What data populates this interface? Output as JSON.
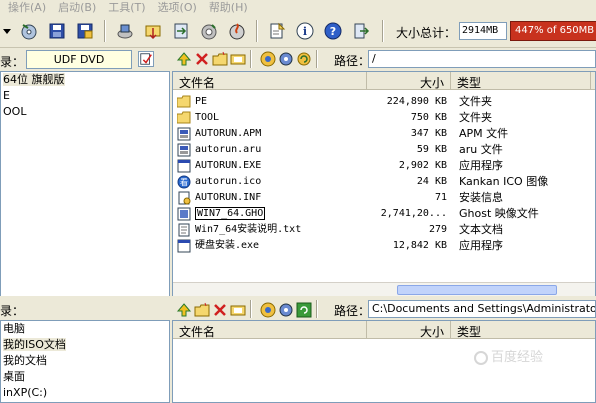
{
  "menu": [
    "操作(A)",
    "启动(B)",
    "工具(T)",
    "选项(O)",
    "帮助(H)"
  ],
  "toolbar": {
    "icons": [
      "dropdown-arrow-icon",
      "cd-icon",
      "save-icon",
      "save-as-icon",
      "mount-icon",
      "extract-icon",
      "convert-icon",
      "properties-icon",
      "burn-icon",
      "new-file-icon",
      "info-icon",
      "help-icon",
      "exit-icon"
    ],
    "total_label": "大小总计：",
    "total_value": "2914MB",
    "capacity_text": "447% of 650MB"
  },
  "top": {
    "left_label": "录：",
    "disc_name": "UDF DVD",
    "tree": [
      "64位 旗舰版",
      "E",
      "OOL"
    ],
    "path_label": "路径：",
    "path": "/",
    "columns": {
      "name": "文件名",
      "size": "大小",
      "type": "类型"
    },
    "files": [
      {
        "icon": "folder-icon",
        "name": "PE",
        "size": "224,890 KB",
        "type": "文件夹"
      },
      {
        "icon": "folder-icon",
        "name": "TOOL",
        "size": "750 KB",
        "type": "文件夹"
      },
      {
        "icon": "apm-file-icon",
        "name": "AUTORUN.APM",
        "size": "347 KB",
        "type": "APM 文件"
      },
      {
        "icon": "aru-file-icon",
        "name": "autorun.aru",
        "size": "59 KB",
        "type": "aru 文件"
      },
      {
        "icon": "exe-file-icon",
        "name": "AUTORUN.EXE",
        "size": "2,902 KB",
        "type": "应用程序"
      },
      {
        "icon": "kankan-ico-icon",
        "name": "autorun.ico",
        "size": "24 KB",
        "type": "Kankan ICO 图像"
      },
      {
        "icon": "inf-file-icon",
        "name": "AUTORUN.INF",
        "size": "71",
        "type": "安装信息"
      },
      {
        "icon": "ghost-file-icon",
        "name": "WIN7_64.GHO",
        "size": "2,741,20...",
        "type": "Ghost 映像文件"
      },
      {
        "icon": "txt-file-icon",
        "name": "Win7_64安装说明.txt",
        "size": "279",
        "type": "文本文档"
      },
      {
        "icon": "exe-file-icon",
        "name": "硬盘安装.exe",
        "size": "12,842 KB",
        "type": "应用程序"
      }
    ]
  },
  "bottom": {
    "left_label": "录：",
    "tree": [
      "电脑",
      "我的ISO文档",
      "我的文档",
      "桌面",
      "inXP(C:)"
    ],
    "path_label": "路径：",
    "path": "C:\\Documents and Settings\\Administrator",
    "columns": {
      "name": "文件名",
      "size": "大小",
      "type": "类型"
    }
  },
  "watermark": "百度经验"
}
